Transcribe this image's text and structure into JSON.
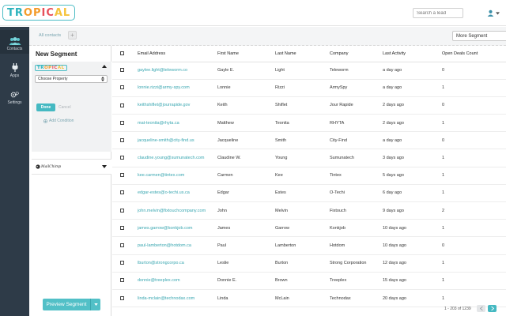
{
  "header": {
    "logo": {
      "p1": "TR",
      "p2": "OP",
      "p3": "IC",
      "p4": "AL"
    },
    "search_placeholder": "Search a lead"
  },
  "nav": {
    "items": [
      {
        "label": "Contacts",
        "icon": "contacts-icon",
        "active": true
      },
      {
        "label": "Apps",
        "icon": "plug-icon",
        "active": false
      },
      {
        "label": "Settings",
        "icon": "gear-icon",
        "active": false
      }
    ]
  },
  "subheader": {
    "breadcrumb": "All contacts",
    "add_tab": "+",
    "more_segment": "More Segment"
  },
  "segment": {
    "title": "New Segment",
    "mini_logo": {
      "p1": "TR",
      "p2": "OP",
      "p3": "IC",
      "p4": "AL"
    },
    "choose_property": "Choose Property",
    "done": "Done",
    "cancel": "Cancel",
    "add_condition": "Add Condition",
    "mailchimp": "MailChimp",
    "preview": "Preview Segment"
  },
  "table": {
    "columns": [
      "Email Address",
      "First Name",
      "Last Name",
      "Company",
      "Last Activity",
      "Open Deals Count"
    ],
    "rows": [
      {
        "email": "gaylee.light@teleworm.co",
        "first": "Gayle E.",
        "last": "Light",
        "company": "Teleworm",
        "activity": "a day ago",
        "deals": "0"
      },
      {
        "email": "lonnie.rizzi@army-spy.com",
        "first": "Lonnie",
        "last": "Rizzi",
        "company": "ArmySpy",
        "activity": "a day ago",
        "deals": "1"
      },
      {
        "email": "keithshiflet@jourrapide.gov",
        "first": "Keith",
        "last": "Shiflet",
        "company": "Jour Rapide",
        "activity": "2 days ago",
        "deals": "0"
      },
      {
        "email": "mat-teonita@rhyta.ca",
        "first": "Matthew",
        "last": "Teonita",
        "company": "RHYTA",
        "activity": "2 days ago",
        "deals": "1"
      },
      {
        "email": "jacqueline-smith@city-find.us",
        "first": "Jacqueline",
        "last": "Smith",
        "company": "City-Find",
        "activity": "a day ago",
        "deals": "0"
      },
      {
        "email": "claudine.young@sumunatech.com",
        "first": "Claudine W.",
        "last": "Young",
        "company": "Sumunatech",
        "activity": "3 days ago",
        "deals": "1"
      },
      {
        "email": "kee.carmen@tintex.com",
        "first": "Carmen",
        "last": "Kee",
        "company": "Tintex",
        "activity": "5 days ago",
        "deals": "1"
      },
      {
        "email": "edgar-estes@o-techi.us.ca",
        "first": "Edgar",
        "last": "Estes",
        "company": "O-Techi",
        "activity": "6 day ago",
        "deals": "1"
      },
      {
        "email": "john.melvin@fixtouchcompany.com",
        "first": "John",
        "last": "Melvin",
        "company": "Fixtouch",
        "activity": "9 days ago",
        "deals": "2"
      },
      {
        "email": "james.garrow@konkjob.com",
        "first": "James",
        "last": "Garrow",
        "company": "Konkjob",
        "activity": "10 days ago",
        "deals": "1"
      },
      {
        "email": "paul-lamberton@hotdom.ca",
        "first": "Paul",
        "last": "Lamberton",
        "company": "Hotdom",
        "activity": "10 days ago",
        "deals": "0"
      },
      {
        "email": "lburton@strongcorpo.ca",
        "first": "Leslie",
        "last": "Burton",
        "company": "Strong Corporation",
        "activity": "12 days ago",
        "deals": "1"
      },
      {
        "email": "donnie@treeplex.com",
        "first": "Donnie E.",
        "last": "Brown",
        "company": "Treeplex",
        "activity": "15 days ago",
        "deals": "1"
      },
      {
        "email": "linda-mclain@technodax.com",
        "first": "Linda",
        "last": "McLain",
        "company": "Technodax",
        "activity": "20 days ago",
        "deals": "1"
      }
    ]
  },
  "pagination": {
    "range": "1 - 203 of 1239"
  },
  "colors": {
    "accent": "#45b9c2",
    "nav_bg": "#2e3b48",
    "link": "#3aa7b1"
  }
}
